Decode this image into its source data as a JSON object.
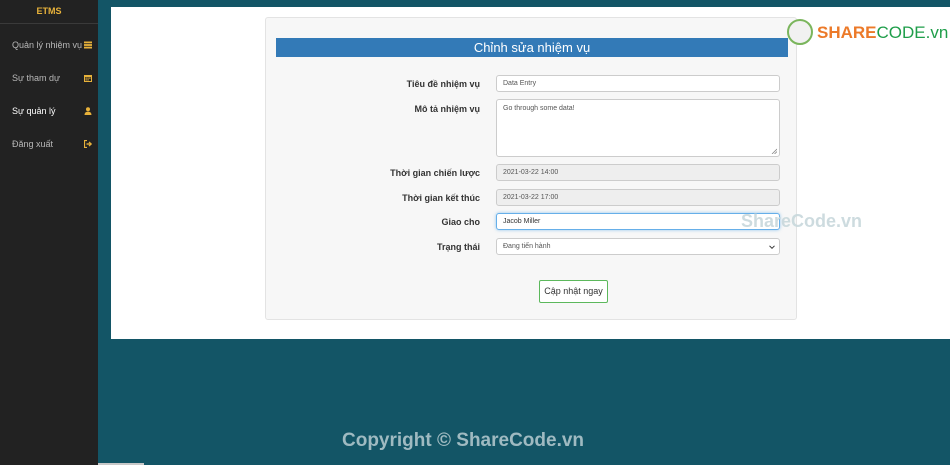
{
  "sidebar": {
    "brand": "ETMS",
    "items": [
      {
        "label": "Quản lý nhiệm vụ",
        "icon": "tasks-icon"
      },
      {
        "label": "Sự tham dự",
        "icon": "calendar-icon"
      },
      {
        "label": "Sự quản lý",
        "icon": "user-icon"
      },
      {
        "label": "Đăng xuất",
        "icon": "logout-icon"
      }
    ]
  },
  "form": {
    "title": "Chỉnh sửa nhiệm vụ",
    "task_title": {
      "label": "Tiêu đề nhiệm vụ",
      "value": "Data Entry"
    },
    "description": {
      "label": "Mô tả nhiệm vụ",
      "value": "Go through some data!"
    },
    "start_time": {
      "label": "Thời gian chiến lược",
      "value": "2021-03-22 14:00"
    },
    "end_time": {
      "label": "Thời gian kết thúc",
      "value": "2021-03-22 17:00"
    },
    "assign_to": {
      "label": "Giao cho",
      "value": "Jacob Miller"
    },
    "status": {
      "label": "Trạng thái",
      "value": "Đang tiến hành"
    },
    "submit_label": "Cập nhật ngay"
  },
  "watermarks": {
    "logo_share": "SHARE",
    "logo_code": "CODE.vn",
    "center": "ShareCode.vn",
    "copyright": "Copyright © ShareCode.vn"
  },
  "colors": {
    "accent": "#337ab7",
    "sidebar": "#222222",
    "brand": "#e8b23a",
    "background": "#135566",
    "button_border": "#5cb85c"
  }
}
